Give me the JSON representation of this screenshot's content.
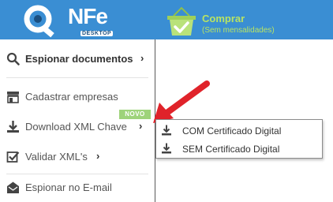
{
  "header": {
    "logo_text": "NFe",
    "logo_sub": "DESKTOP",
    "buy_title": "Comprar",
    "buy_subtitle": "(Sem mensalidades)"
  },
  "menu": {
    "items": [
      {
        "label": "Espionar documentos",
        "icon": "search-icon"
      },
      {
        "label": "Cadastrar empresas",
        "icon": "store-icon"
      },
      {
        "label": "Download XML Chave",
        "icon": "download-icon"
      },
      {
        "label": "Validar XML's",
        "icon": "check-square-icon"
      },
      {
        "label": "Espionar no E-mail",
        "icon": "envelope-icon"
      }
    ],
    "badge": "NOVO"
  },
  "submenu": {
    "items": [
      {
        "label": "COM Certificado Digital",
        "icon": "download-icon"
      },
      {
        "label": "SEM Certificado Digital",
        "icon": "download-icon"
      }
    ]
  },
  "colors": {
    "header_bg": "#3a8ed3",
    "buy_text": "#b7e364",
    "badge_bg": "#9ed37a",
    "arrow": "#e0232a"
  }
}
